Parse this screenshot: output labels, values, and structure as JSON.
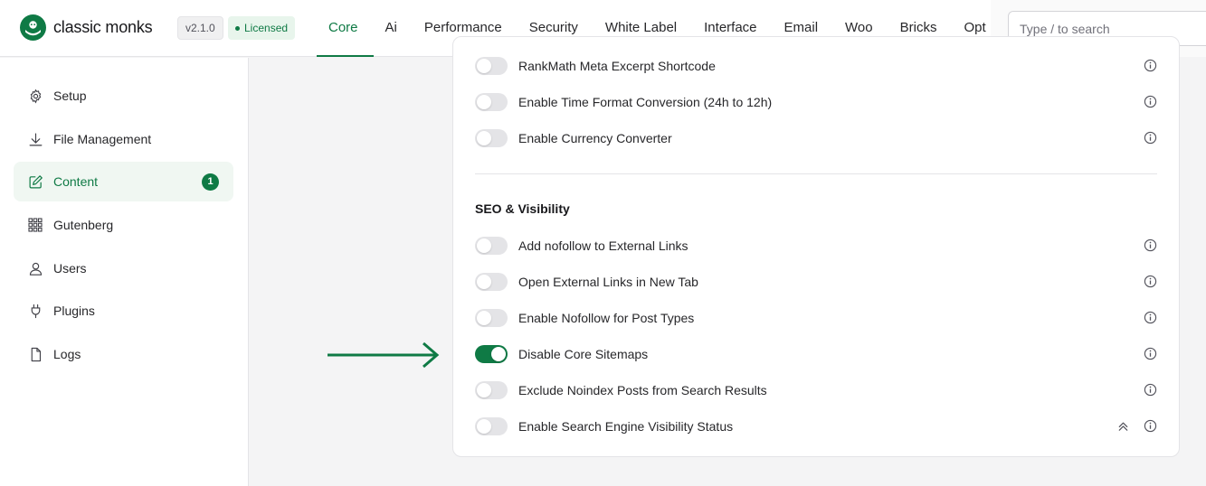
{
  "brand": {
    "name": "classic monks",
    "version": "v2.1.0",
    "license_status": "Licensed",
    "accent_color": "#0f7a45"
  },
  "nav": {
    "items": [
      {
        "label": "Core",
        "active": true
      },
      {
        "label": "Ai"
      },
      {
        "label": "Performance"
      },
      {
        "label": "Security"
      },
      {
        "label": "White Label"
      },
      {
        "label": "Interface"
      },
      {
        "label": "Email"
      },
      {
        "label": "Woo"
      },
      {
        "label": "Bricks"
      },
      {
        "label": "Opt"
      }
    ]
  },
  "search": {
    "placeholder": "Type / to search",
    "value": ""
  },
  "sidebar": {
    "items": [
      {
        "label": "Setup",
        "icon": "gear-icon"
      },
      {
        "label": "File Management",
        "icon": "download-icon"
      },
      {
        "label": "Content",
        "icon": "edit-icon",
        "active": true,
        "badge": "1"
      },
      {
        "label": "Gutenberg",
        "icon": "grid-icon"
      },
      {
        "label": "Users",
        "icon": "user-icon"
      },
      {
        "label": "Plugins",
        "icon": "plug-icon"
      },
      {
        "label": "Logs",
        "icon": "file-icon"
      }
    ]
  },
  "settings": {
    "top_rows": [
      {
        "label": "RankMath Meta Excerpt Shortcode",
        "enabled": false
      },
      {
        "label": "Enable Time Format Conversion (24h to 12h)",
        "enabled": false
      },
      {
        "label": "Enable Currency Converter",
        "enabled": false
      }
    ],
    "seo_section": {
      "title": "SEO & Visibility",
      "rows": [
        {
          "label": "Add nofollow to External Links",
          "enabled": false
        },
        {
          "label": "Open External Links in New Tab",
          "enabled": false
        },
        {
          "label": "Enable Nofollow for Post Types",
          "enabled": false
        },
        {
          "label": "Disable Core Sitemaps",
          "enabled": true
        },
        {
          "label": "Exclude Noindex Posts from Search Results",
          "enabled": false
        },
        {
          "label": "Enable Search Engine Visibility Status",
          "enabled": false
        }
      ]
    }
  }
}
